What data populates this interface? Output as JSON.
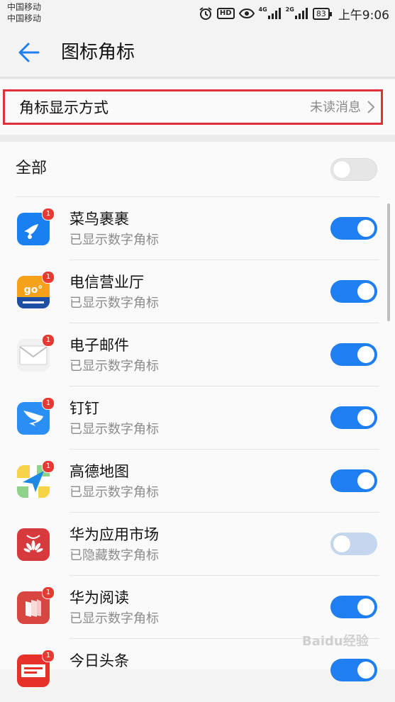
{
  "status_bar": {
    "carrier_1": "中国移动",
    "carrier_2": "中国移动",
    "hd_label": "HD",
    "network_1": "4G",
    "network_2": "2G",
    "battery": "83",
    "time": "上午9:06",
    "icons": [
      "alarm-icon",
      "hd-icon",
      "eye-comfort-icon",
      "signal-icon",
      "battery-icon"
    ]
  },
  "header": {
    "back_icon": "back-arrow-icon",
    "title": "图标角标"
  },
  "badge_mode": {
    "label": "角标显示方式",
    "value": "未读消息",
    "chevron_icon": "chevron-right-icon"
  },
  "all": {
    "label": "全部",
    "enabled": false
  },
  "apps": [
    {
      "name": "菜鸟裹裹",
      "status": "已显示数字角标",
      "badge": "1",
      "enabled": true,
      "icon": "cainiao-icon"
    },
    {
      "name": "电信营业厅",
      "status": "已显示数字角标",
      "badge": "1",
      "enabled": true,
      "icon": "telecom-icon"
    },
    {
      "name": "电子邮件",
      "status": "已显示数字角标",
      "badge": "1",
      "enabled": true,
      "icon": "email-icon"
    },
    {
      "name": "钉钉",
      "status": "已显示数字角标",
      "badge": "1",
      "enabled": true,
      "icon": "dingtalk-icon"
    },
    {
      "name": "高德地图",
      "status": "已显示数字角标",
      "badge": "1",
      "enabled": true,
      "icon": "amap-icon"
    },
    {
      "name": "华为应用市场",
      "status": "已隐藏数字角标",
      "badge": "",
      "enabled": false,
      "icon": "appgallery-icon"
    },
    {
      "name": "华为阅读",
      "status": "已显示数字角标",
      "badge": "1",
      "enabled": true,
      "icon": "huawei-reader-icon"
    },
    {
      "name": "今日头条",
      "status": "",
      "badge": "1",
      "enabled": true,
      "icon": "toutiao-icon"
    }
  ],
  "colors": {
    "accent": "#1f7ff0",
    "badge": "#e83a33",
    "highlight_border": "#e0313b"
  },
  "watermark": "Baidu经验"
}
